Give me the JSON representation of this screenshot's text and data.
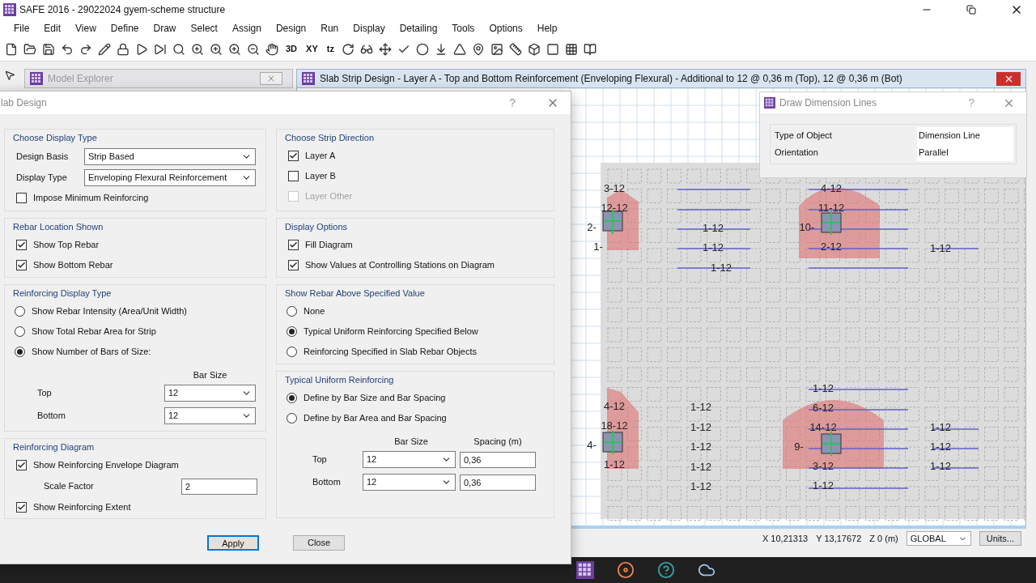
{
  "window": {
    "title": "SAFE 2016 - 29022024 gyem-scheme structure"
  },
  "menu": [
    "File",
    "Edit",
    "View",
    "Define",
    "Draw",
    "Select",
    "Assign",
    "Design",
    "Run",
    "Display",
    "Detailing",
    "Tools",
    "Options",
    "Help"
  ],
  "toolbar": {
    "text_buttons": [
      "3D",
      "XY",
      "tz"
    ]
  },
  "model_explorer": {
    "title": "Model Explorer"
  },
  "plan_window": {
    "title": "Slab Strip Design - Layer A - Top and Bottom Reinforcement (Enveloping Flexural)  - Additional to 12 @ 0,36 m (Top), 12 @ 0,36 m (Bot)",
    "strip_groups": [
      {
        "labels": [
          "3-12",
          "12-12",
          "2-",
          "1-"
        ]
      },
      {
        "labels": [
          "1-12",
          "1-12"
        ]
      },
      {
        "labels": [
          "1-12"
        ]
      },
      {
        "labels": [
          "4-12",
          "11-12",
          "10-",
          "2-12"
        ]
      },
      {
        "labels": [
          "1-12"
        ]
      },
      {
        "labels": [
          "4-12",
          "18-12",
          "4-",
          "1-12"
        ]
      },
      {
        "labels": [
          "1-12",
          "1-12",
          "1-12",
          "1-12",
          "1-12"
        ]
      },
      {
        "labels": [
          "1-12",
          "6-12",
          "14-12",
          "9-",
          "3-12",
          "1-12"
        ]
      },
      {
        "labels": [
          "1-12",
          "1-12",
          "1-12"
        ]
      }
    ]
  },
  "status_bar": {
    "coordinates": [
      "X 10,21313",
      "Y 13,17672",
      "Z 0 (m)"
    ],
    "coordinate_system": "GLOBAL",
    "units_button": "Units..."
  },
  "slab_design_dialog": {
    "title": "lab Design",
    "help": "?",
    "left_column": [
      {
        "title": "Choose Display Type",
        "items": [
          {
            "kind": "select",
            "label": "Design Basis",
            "value": "Strip Based"
          },
          {
            "kind": "select",
            "label": "Display Type",
            "value": "Enveloping Flexural Reinforcement"
          },
          {
            "kind": "checkbox",
            "label": "Impose Minimum Reinforcing",
            "checked": false,
            "disabled": false
          }
        ]
      },
      {
        "title": "Rebar Location Shown",
        "items": [
          {
            "kind": "checkbox",
            "label": "Show Top Rebar",
            "checked": true,
            "disabled": false
          },
          {
            "kind": "checkbox",
            "label": "Show Bottom Rebar",
            "checked": true,
            "disabled": false
          }
        ]
      },
      {
        "title": "Reinforcing Display Type",
        "items": [
          {
            "kind": "radio",
            "label": "Show Rebar Intensity (Area/Unit Width)",
            "selected": false
          },
          {
            "kind": "radio",
            "label": "Show Total Rebar Area for Strip",
            "selected": false
          },
          {
            "kind": "radio",
            "label": "Show Number of Bars of Size:",
            "selected": true
          },
          {
            "kind": "bar_table",
            "header": "Bar Size",
            "rows": [
              {
                "label": "Top",
                "value": "12"
              },
              {
                "label": "Bottom",
                "value": "12"
              }
            ]
          }
        ]
      },
      {
        "title": "Reinforcing Diagram",
        "items": [
          {
            "kind": "checkbox",
            "label": "Show Reinforcing Envelope Diagram",
            "checked": true,
            "disabled": false
          },
          {
            "kind": "field",
            "label": "Scale Factor",
            "value": "2"
          },
          {
            "kind": "checkbox",
            "label": "Show Reinforcing Extent",
            "checked": true,
            "disabled": false
          }
        ]
      }
    ],
    "right_column": [
      {
        "title": "Choose Strip Direction",
        "items": [
          {
            "kind": "checkbox",
            "label": "Layer A",
            "checked": true,
            "disabled": false
          },
          {
            "kind": "checkbox",
            "label": "Layer B",
            "checked": false,
            "disabled": false
          },
          {
            "kind": "checkbox",
            "label": "Layer Other",
            "checked": false,
            "disabled": true
          }
        ]
      },
      {
        "title": "Display Options",
        "items": [
          {
            "kind": "checkbox",
            "label": "Fill Diagram",
            "checked": true,
            "disabled": false
          },
          {
            "kind": "checkbox",
            "label": "Show Values at Controlling Stations on Diagram",
            "checked": true,
            "disabled": false
          }
        ]
      },
      {
        "title": "Show Rebar Above Specified Value",
        "items": [
          {
            "kind": "radio",
            "label": "None",
            "selected": false
          },
          {
            "kind": "radio",
            "label": "Typical Uniform Reinforcing Specified Below",
            "selected": true
          },
          {
            "kind": "radio",
            "label": "Reinforcing Specified in Slab Rebar Objects",
            "selected": false
          }
        ]
      },
      {
        "title": "Typical Uniform Reinforcing",
        "items": [
          {
            "kind": "radio",
            "label": "Define by Bar Size and Bar Spacing",
            "selected": true
          },
          {
            "kind": "radio",
            "label": "Define by Bar Area and Bar Spacing",
            "selected": false
          },
          {
            "kind": "spacing_table",
            "header": "Bar Size",
            "spacing_header": "Spacing (m)",
            "rows": [
              {
                "label": "Top",
                "value": "12",
                "spacing": "0,36"
              },
              {
                "label": "Bottom",
                "value": "12",
                "spacing": "0,36"
              }
            ]
          }
        ]
      }
    ],
    "buttons": [
      {
        "label": "Apply",
        "default": true
      },
      {
        "label": "Close",
        "default": false
      }
    ]
  },
  "dimension_dialog": {
    "title": "Draw Dimension Lines",
    "help": "?",
    "properties": [
      {
        "name": "Type of Object",
        "value": "Dimension Line"
      },
      {
        "name": "Orientation",
        "value": "Parallel"
      }
    ]
  }
}
